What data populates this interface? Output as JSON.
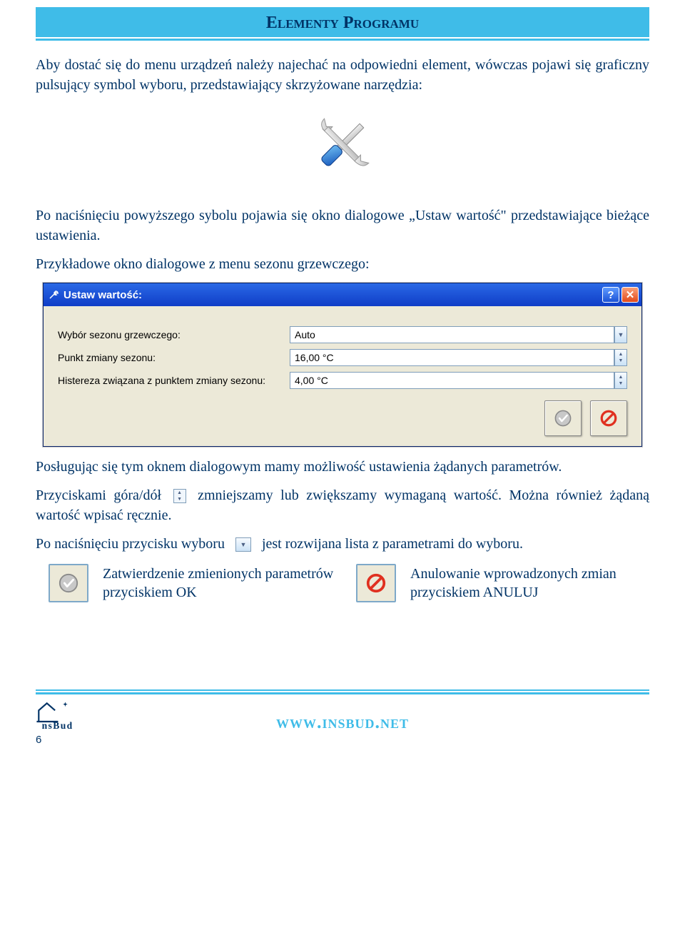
{
  "header": {
    "title": "Elementy Programu"
  },
  "para1": "Aby dostać się do menu urządzeń należy najechać na odpowiedni element, wówczas pojawi się graficzny pulsujący symbol wyboru, przedstawiający skrzyżowane narzędzia:",
  "para2": "Po naciśnięciu powyższego sybolu pojawia się okno dialogowe „Ustaw wartość\" przedstawiające bieżące ustawienia.",
  "para3": "Przykładowe okno dialogowe z menu sezonu grzewczego:",
  "dialog": {
    "title": "Ustaw wartość:",
    "help_symbol": "?",
    "close_symbol": "✕",
    "rows": [
      {
        "label": "Wybór sezonu grzewczego:",
        "value": "Auto",
        "type": "dropdown"
      },
      {
        "label": "Punkt zmiany sezonu:",
        "value": "16,00 °C",
        "type": "spin"
      },
      {
        "label": "Histereza związana z punktem zmiany sezonu:",
        "value": "4,00 °C",
        "type": "spin"
      }
    ]
  },
  "para4": "Posługując się tym oknem dialogowym mamy możliwość ustawienia żądanych parametrów.",
  "para5_a": "Przyciskami góra/dół",
  "para5_b": "zmniejszamy lub zwiększamy wymaganą wartość. Można również żądaną wartość wpisać ręcznie.",
  "para6_a": "Po naciśnięciu przycisku wyboru",
  "para6_b": "jest rozwijana lista z parametrami do wyboru.",
  "legend_ok": "Zatwierdzenie zmienionych parametrów przyciskiem OK",
  "legend_cancel": "Anulowanie wprowadzonych zmian przyciskiem ANULUJ",
  "footer": {
    "url": "www.insbud.net",
    "page": "6",
    "logo_text": "nsBud"
  }
}
